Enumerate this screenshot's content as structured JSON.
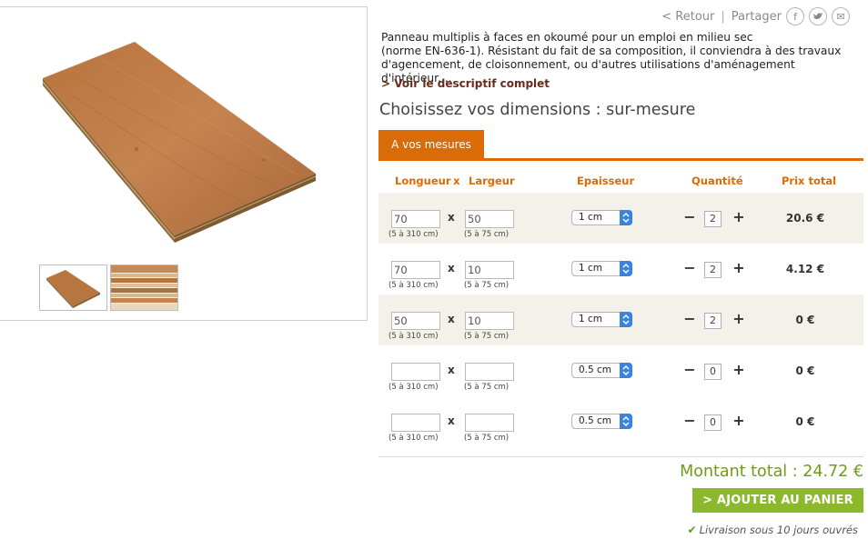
{
  "share": {
    "back_label": "< Retour",
    "separator": "|",
    "share_label": "Partager",
    "icons": [
      {
        "name": "facebook-icon",
        "glyph": "f"
      },
      {
        "name": "twitter-icon",
        "glyph": "♥"
      },
      {
        "name": "email-icon",
        "glyph": "✉"
      }
    ]
  },
  "product": {
    "description_line1": "Panneau multiplis à faces en okoumé pour un emploi en milieu sec",
    "description_line2": "(norme EN-636-1). Résistant du fait de sa composition, il conviendra à des travaux",
    "description_line3": "d'agencement, de cloisonnement, ou d'autres utilisations d'aménagement d'intérieur....",
    "more_link": "> Voir le descriptif complet",
    "choose_title": "Choisissez vos dimensions : sur-mesure"
  },
  "tab": {
    "label": "A vos mesures"
  },
  "table": {
    "headers": {
      "length": "Longueur",
      "x": "x",
      "width": "Largeur",
      "thickness": "Epaisseur",
      "quantity": "Quantité",
      "total": "Prix total"
    },
    "length_hint": "(5 à 310 cm)",
    "width_hint": "(5 à 75 cm)",
    "x_sign": "x",
    "minus": "−",
    "plus": "+",
    "rows": [
      {
        "length": "70",
        "width": "50",
        "thickness": "1 cm",
        "qty": "2",
        "price": "20.6 €"
      },
      {
        "length": "70",
        "width": "10",
        "thickness": "1 cm",
        "qty": "2",
        "price": "4.12 €"
      },
      {
        "length": "50",
        "width": "10",
        "thickness": "1 cm",
        "qty": "2",
        "price": "0 €"
      },
      {
        "length": "",
        "width": "",
        "thickness": "0.5 cm",
        "qty": "0",
        "price": "0 €"
      },
      {
        "length": "",
        "width": "",
        "thickness": "0.5 cm",
        "qty": "0",
        "price": "0 €"
      }
    ]
  },
  "summary": {
    "total_label": "Montant total : 24.72 €",
    "cart_button": "> AJOUTER AU PANIER",
    "delivery": "Livraison sous 10 jours ouvrés"
  },
  "colors": {
    "accent_orange": "#d96b09",
    "accent_green": "#8cb92b",
    "total_green": "#6e9c18",
    "row_shade": "#f3f1e9"
  }
}
